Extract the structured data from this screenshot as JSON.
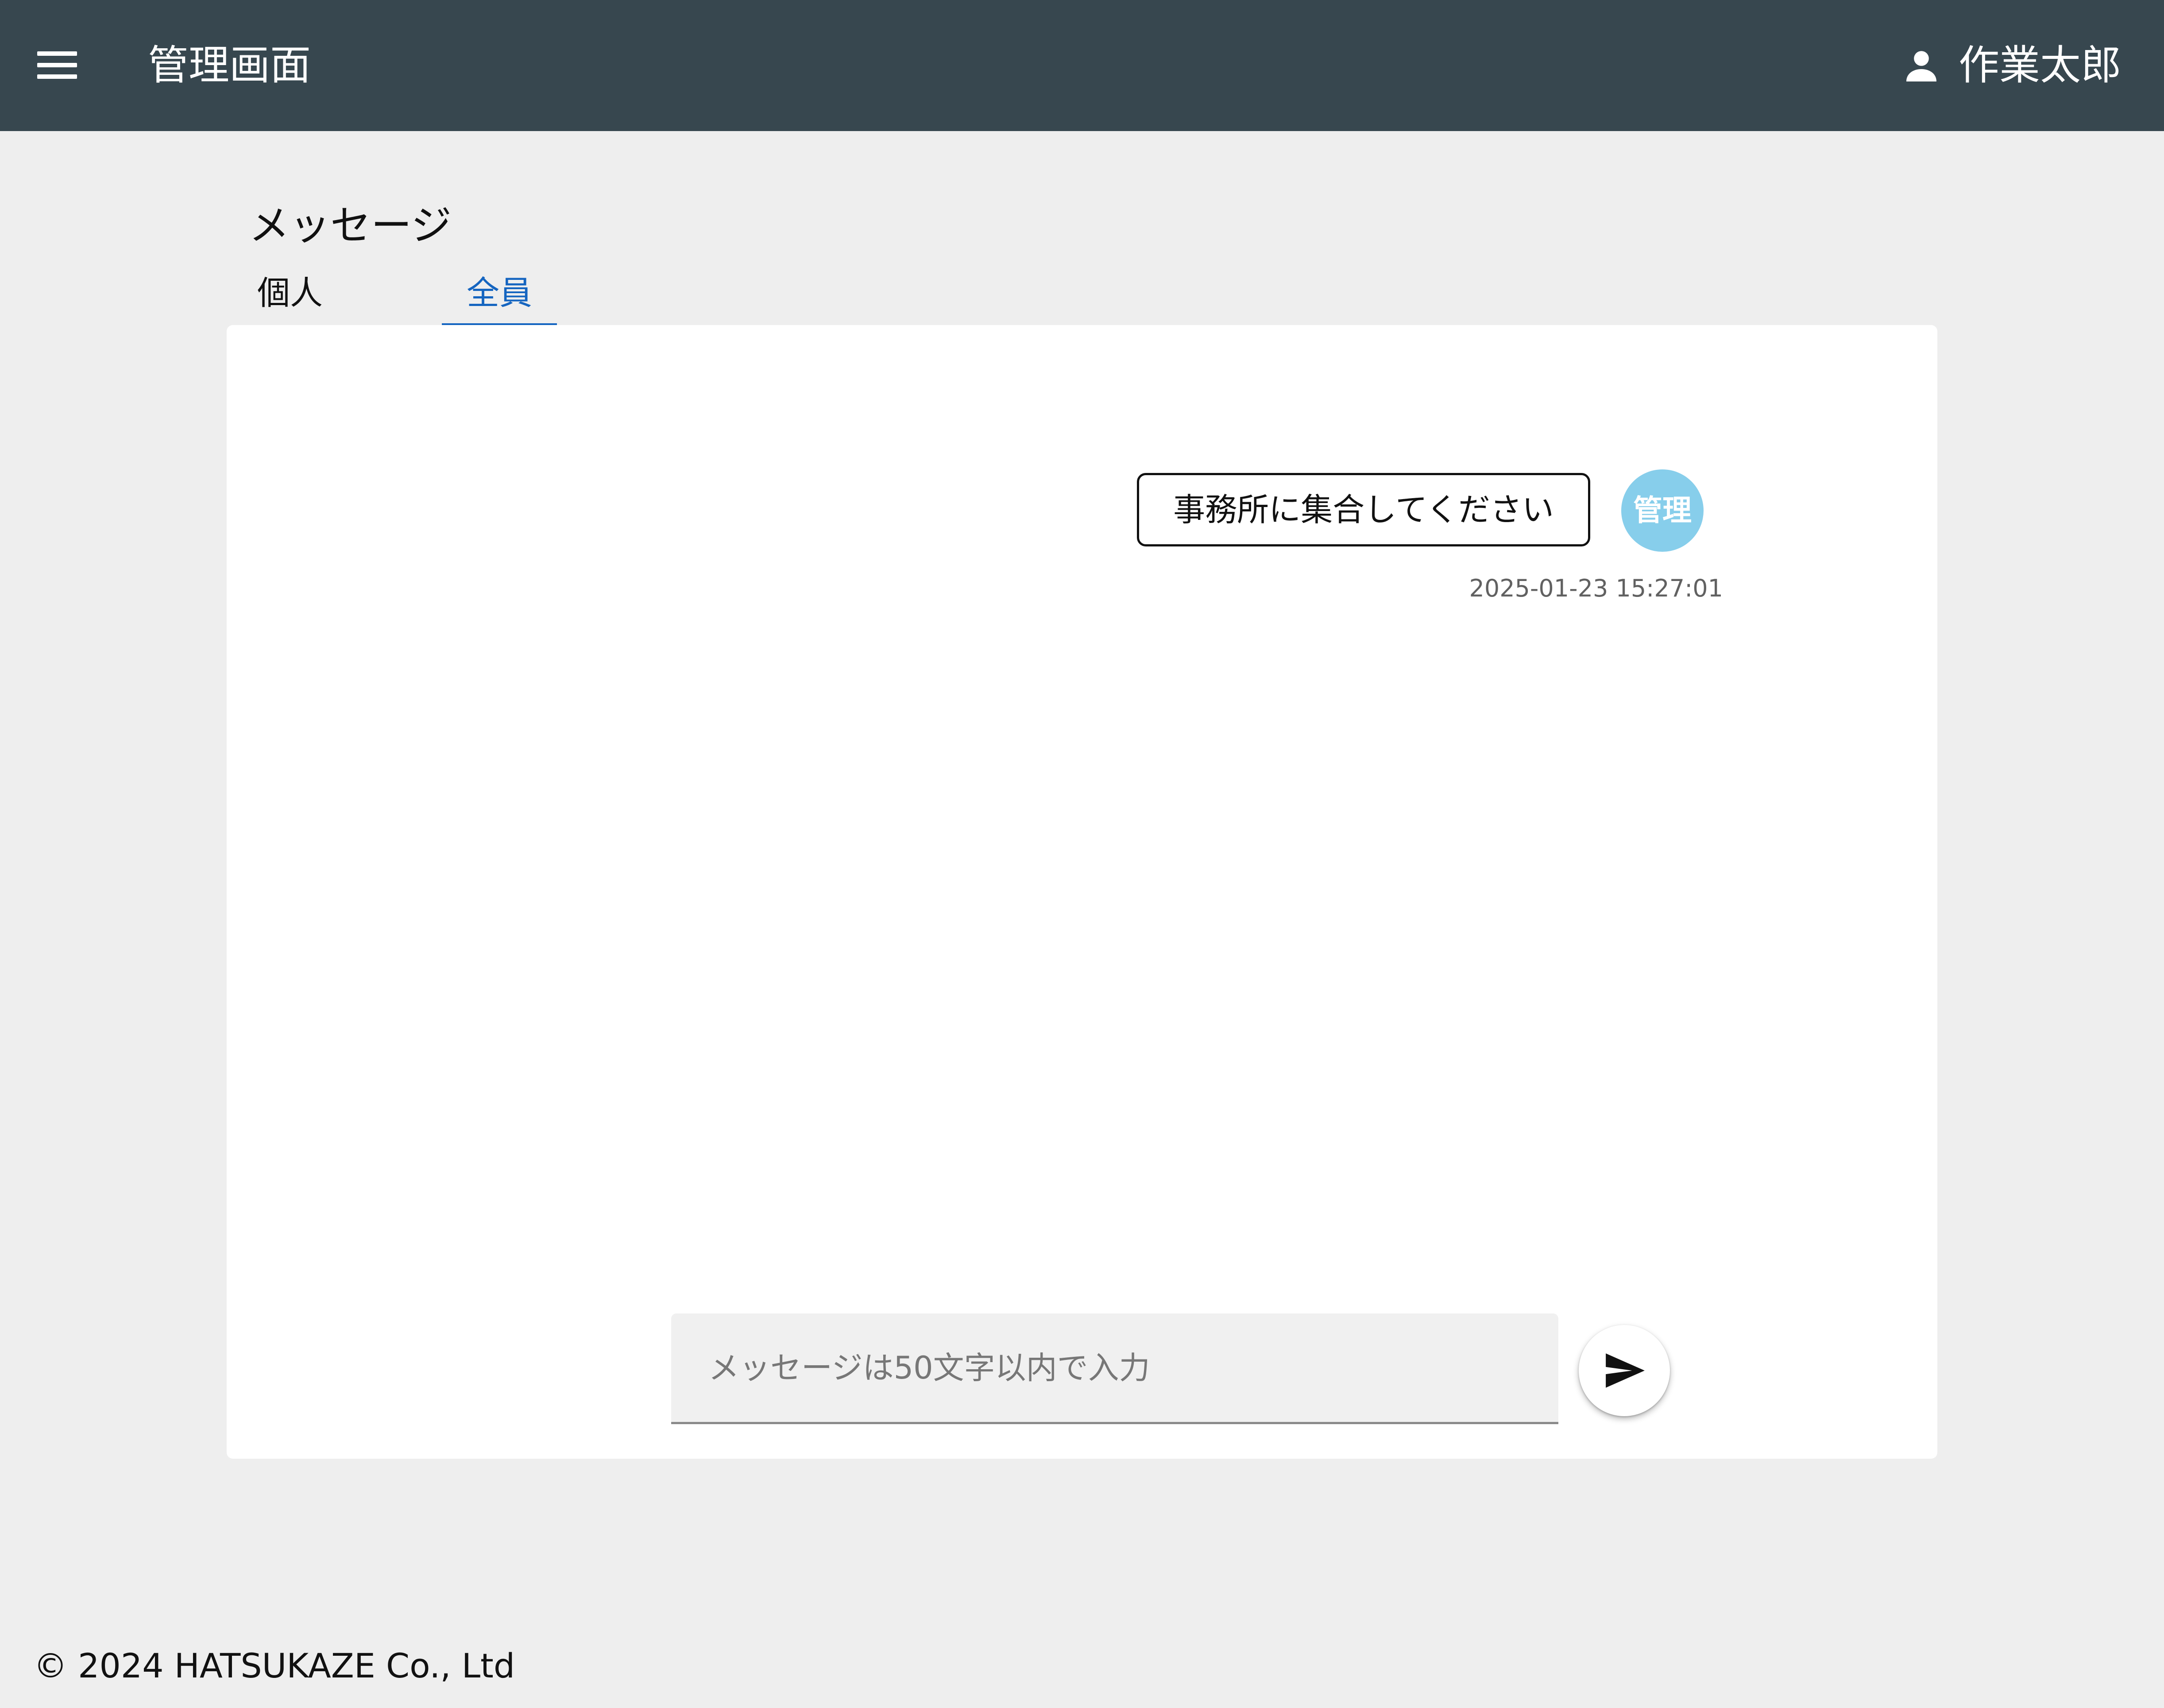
{
  "header": {
    "menu_icon": "menu-icon",
    "title": "管理画面",
    "user_icon": "person-icon",
    "user_name": "作業太郎",
    "background_color": "#37474f"
  },
  "page": {
    "title": "メッセージ",
    "tabs": [
      {
        "label": "個人",
        "active": false
      },
      {
        "label": "全員",
        "active": true
      }
    ],
    "active_tab_color": "#1565c0"
  },
  "messages": [
    {
      "text": "事務所に集合してください",
      "sender_badge": "管理",
      "badge_color": "#87ceeb",
      "timestamp": "2025-01-23 15:27:01"
    }
  ],
  "composer": {
    "placeholder": "メッセージは50文字以内で入力",
    "value": "",
    "send_icon": "send-icon"
  },
  "footer": {
    "copyright": "© 2024 HATSUKAZE Co., Ltd"
  }
}
